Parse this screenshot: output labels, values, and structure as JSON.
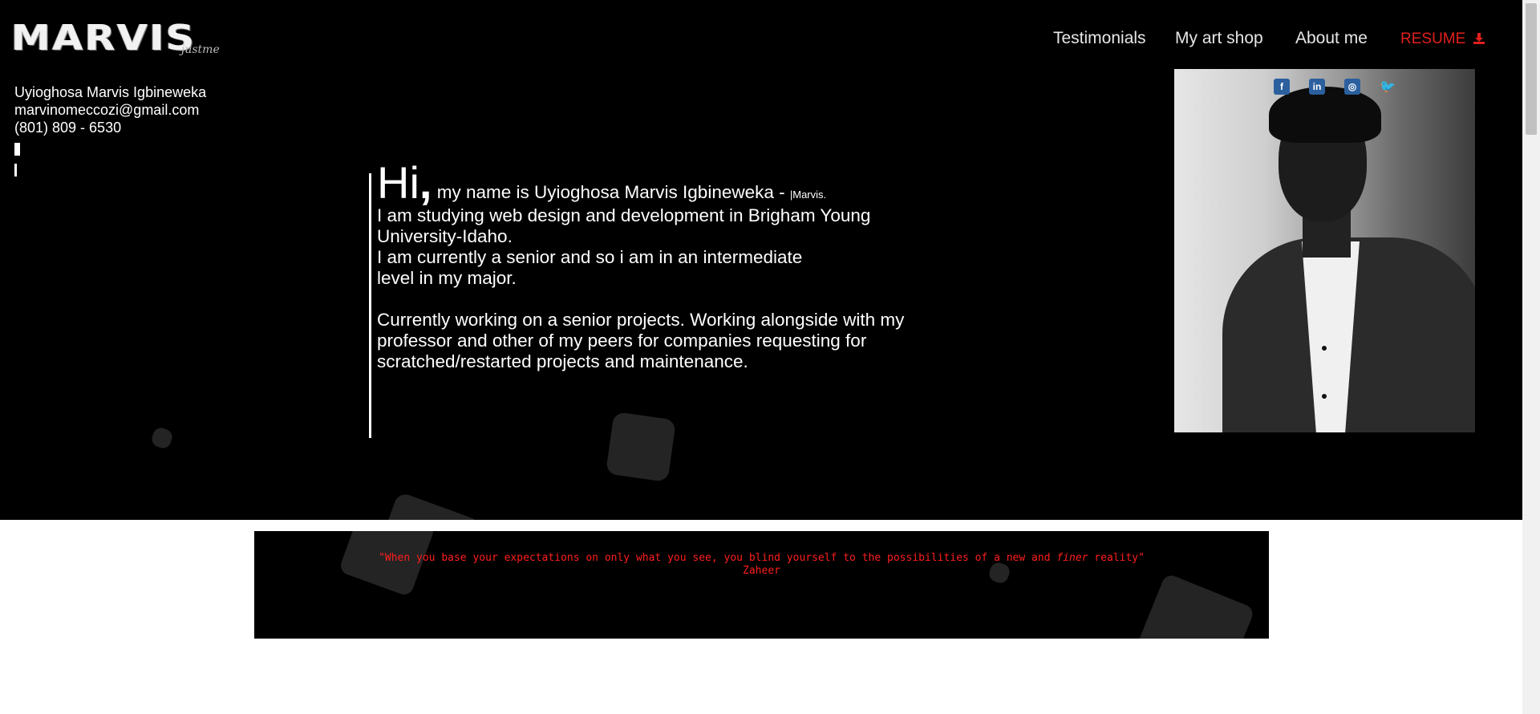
{
  "logo": {
    "main": "MARVIS",
    "sub": "justme"
  },
  "contact": {
    "name": "Uyioghosa Marvis Igbineweka",
    "email": "marvinomeccozi@gmail.com",
    "phone": "(801) 809 - 6530"
  },
  "nav": {
    "items": [
      "Testimonials",
      "My art shop",
      "About me"
    ],
    "resume": "RESUME",
    "resume_icon": "download-icon",
    "resume_color": "#e0201c"
  },
  "social": [
    {
      "icon": "facebook-icon",
      "glyph": "f"
    },
    {
      "icon": "linkedin-icon",
      "glyph": "in"
    },
    {
      "icon": "instagram-icon",
      "glyph": "◎"
    },
    {
      "icon": "twitter-icon",
      "glyph": "🐦"
    }
  ],
  "intro": {
    "hi": "Hi",
    "comma": ",",
    "name_line": " my name is Uyioghosa Marvis Igbineweka - ",
    "nickname": "|Marvis.",
    "lines": [
      "I am studying web design and development in Brigham Young",
      "University-Idaho.",
      "I am currently a senior and so i am in an intermediate",
      "level in my major."
    ],
    "paragraph2": [
      "Currently working on a senior projects. Working alongside with my",
      "professor and other of my peers for companies requesting for",
      "scratched/restarted projects and maintenance."
    ]
  },
  "quote": {
    "before": "\"When you base your expectations on only what you see, you blind yourself to the possibilities of a new and ",
    "emph": "finer",
    "after": " reality\"",
    "author": "Zaheer",
    "color": "#ff1e1e"
  }
}
